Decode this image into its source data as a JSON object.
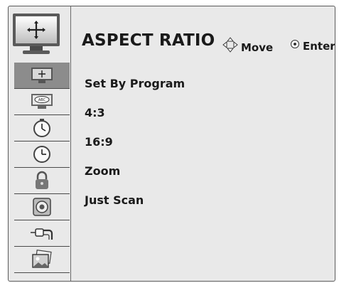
{
  "header": {
    "title": "ASPECT RATIO",
    "move_label": "Move",
    "enter_label": "Enter"
  },
  "menu_icon": "aspect-ratio-picture-icon",
  "sidebar": {
    "items": [
      {
        "icon": "picture-icon",
        "selected": true
      },
      {
        "icon": "audio-icon",
        "selected": false
      },
      {
        "icon": "timer-icon",
        "selected": false
      },
      {
        "icon": "clock-icon",
        "selected": false
      },
      {
        "icon": "lock-icon",
        "selected": false
      },
      {
        "icon": "speaker-icon",
        "selected": false
      },
      {
        "icon": "input-cable-icon",
        "selected": false
      },
      {
        "icon": "photo-icon",
        "selected": false
      }
    ]
  },
  "options": [
    "Set By Program",
    "4:3",
    "16:9",
    "Zoom",
    "Just Scan"
  ],
  "colors": {
    "background": "#e9e9e9",
    "selected_item": "#8c8c8c",
    "border": "#5a5a5a",
    "text": "#1a1a1a"
  }
}
